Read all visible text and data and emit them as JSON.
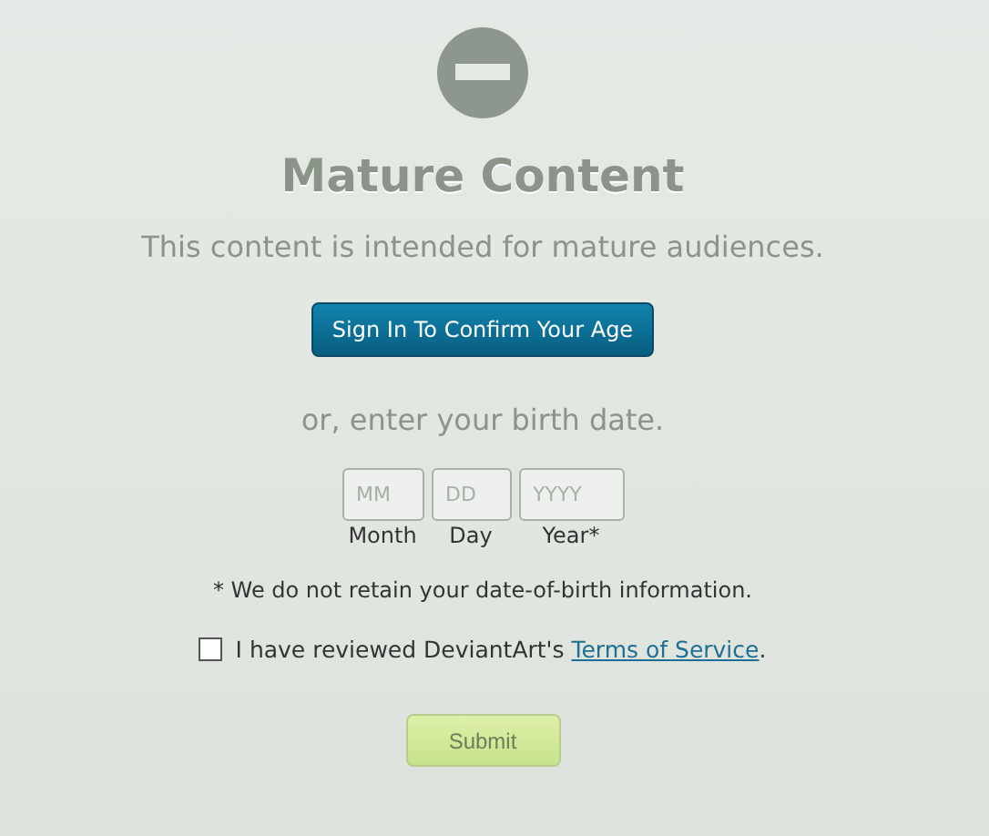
{
  "title": "Mature Content",
  "message": "This content is intended for mature audiences.",
  "signin_button": "Sign In To Confirm Your Age",
  "alternative": "or, enter your birth date.",
  "date_fields": [
    {
      "placeholder": "MM",
      "label": "Month"
    },
    {
      "placeholder": "DD",
      "label": "Day"
    },
    {
      "placeholder": "YYYY",
      "label": "Year*"
    }
  ],
  "note": "* We do not retain your date-of-birth information.",
  "agreement": {
    "checked": false,
    "text": "I have reviewed DeviantArt's ",
    "link": "Terms of Service",
    "after": "."
  },
  "submit_button": "Submit"
}
